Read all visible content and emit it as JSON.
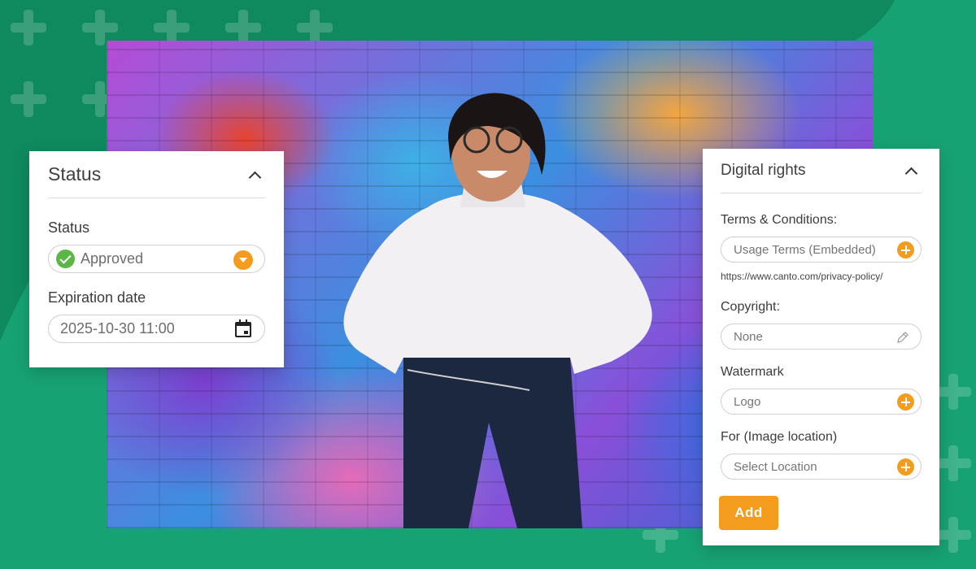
{
  "status_panel": {
    "title": "Status",
    "status_label": "Status",
    "status_value": "Approved",
    "expiration_label": "Expiration date",
    "expiration_value": "2025-10-30 11:00"
  },
  "rights_panel": {
    "title": "Digital rights",
    "terms_label": "Terms & Conditions:",
    "terms_placeholder": "Usage Terms (Embedded)",
    "terms_link": "https://www.canto.com/privacy-policy/",
    "copyright_label": "Copyright:",
    "copyright_value": "None",
    "watermark_label": "Watermark",
    "watermark_value": "Logo",
    "location_label": "For (Image location)",
    "location_placeholder": "Select Location",
    "add_label": "Add"
  },
  "colors": {
    "background": "#17a274",
    "accent": "#f39c1d",
    "approved": "#5bb547"
  }
}
